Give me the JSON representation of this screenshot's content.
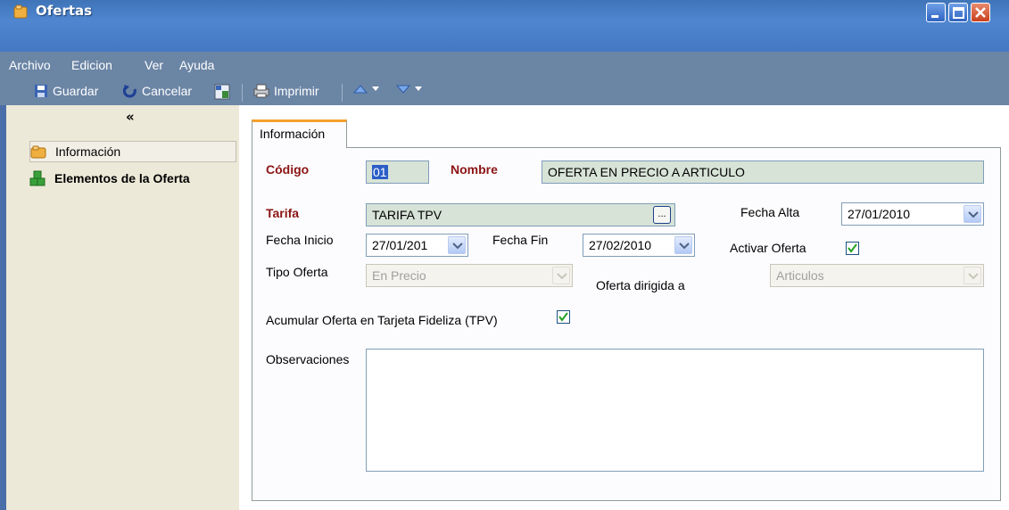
{
  "window": {
    "title": "Ofertas"
  },
  "menu": [
    "Archivo",
    "Edicion",
    "Ver",
    "Ayuda"
  ],
  "toolbar": {
    "save": "Guardar",
    "cancel": "Cancelar",
    "print": "Imprimir"
  },
  "sidebar": {
    "collapse": "«",
    "items": [
      "Información",
      "Elementos de la Oferta"
    ]
  },
  "tab": {
    "label": "Información"
  },
  "form": {
    "codigo_label": "Código",
    "codigo": "01",
    "nombre_label": "Nombre",
    "nombre": "OFERTA EN PRECIO A ARTICULO",
    "tarifa_label": "Tarifa",
    "tarifa": "TARIFA TPV",
    "fecha_alta_label": "Fecha Alta",
    "fecha_alta": "27/01/2010",
    "fecha_inicio_label": "Fecha Inicio",
    "fecha_inicio": "27/01/201",
    "fecha_fin_label": "Fecha Fin",
    "fecha_fin": "27/02/2010",
    "activar_label": "Activar Oferta",
    "activar_checked": true,
    "tipo_label": "Tipo Oferta",
    "tipo": "En Precio",
    "dirigida_label": "Oferta dirigida a",
    "dirigida": "Articulos",
    "acumular_label": "Acumular Oferta en Tarjeta Fideliza (TPV)",
    "acumular_checked": true,
    "observaciones_label": "Observaciones",
    "observaciones": "",
    "ellipsis": "..."
  },
  "colors": {
    "titlebar": "#4478c2",
    "bar": "#6b85a5",
    "required": "#8b1414",
    "readonly_bg": "#d7e3d7",
    "tab_accent": "#f2a12e"
  }
}
